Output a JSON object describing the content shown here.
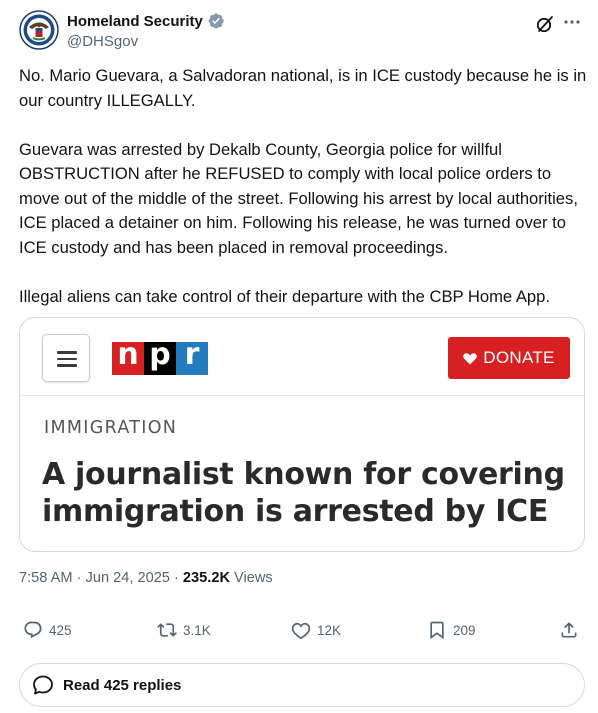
{
  "author": {
    "display_name": "Homeland Security",
    "handle": "@DHSgov",
    "verified_badge_color": "#829aab"
  },
  "icons": {
    "avatar": "dhs-seal-icon",
    "verified": "verified-badge-icon",
    "grok": "grok-icon",
    "more": "more-icon"
  },
  "tweet": {
    "paragraphs": [
      "No. Mario Guevara, a Salvadoran national, is in ICE custody because he is in our country ILLEGALLY.",
      "Guevara was arrested by Dekalb County, Georgia police for willful OBSTRUCTION after he REFUSED to comply with local police orders to move out of the middle of the street. Following his arrest by local authorities, ICE placed a detainer on him. Following his release, he was turned over to ICE custody and has been placed in removal proceedings.",
      "Illegal aliens can take control of their departure with the CBP Home App."
    ]
  },
  "card": {
    "logo_letters": [
      "n",
      "p",
      "r"
    ],
    "logo_colors": [
      "#d62021",
      "#000000",
      "#237bbd"
    ],
    "donate_label": "DONATE",
    "donate_color": "#d62021",
    "kicker": "IMMIGRATION",
    "headline": "A journalist known for covering immigration is arrested by ICE"
  },
  "meta": {
    "time": "7:58 AM",
    "date": "Jun 24, 2025",
    "views_count": "235.2K",
    "views_label": "Views"
  },
  "actions": {
    "replies": "425",
    "reposts": "3.1K",
    "likes": "12K",
    "bookmarks": "209"
  },
  "read_replies_label": "Read 425 replies",
  "colors": {
    "text": "#0f1419",
    "secondary": "#536471",
    "border": "#cfd9de"
  }
}
